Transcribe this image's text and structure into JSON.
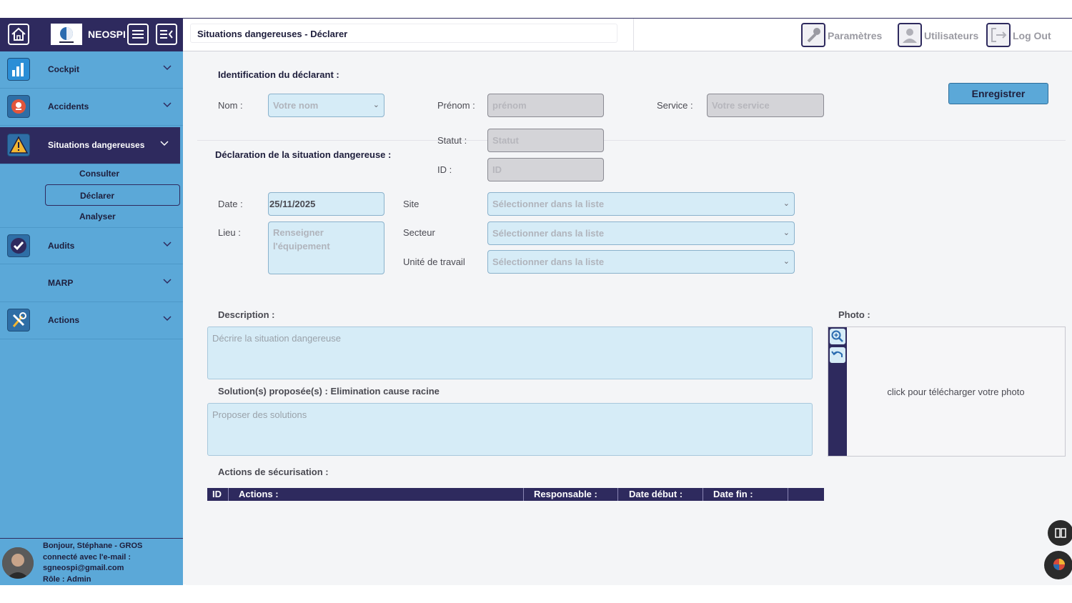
{
  "sidebar": {
    "brand": "NEOSPI",
    "items": [
      {
        "label": "Cockpit"
      },
      {
        "label": "Accidents"
      },
      {
        "label": "Situations dangereuses"
      },
      {
        "label": "Audits"
      },
      {
        "label": "MARP"
      },
      {
        "label": "Actions"
      }
    ],
    "subitems": [
      {
        "label": "Consulter"
      },
      {
        "label": "Déclarer"
      },
      {
        "label": "Analyser"
      }
    ],
    "user": {
      "line1": "Bonjour, Stéphane - GROS",
      "line2": "connecté avec l'e-mail :",
      "line3": "sgneospi@gmail.com",
      "line4": "Rôle : Admin"
    }
  },
  "header": {
    "title": "Situations dangereuses - Déclarer",
    "buttons": [
      {
        "label": "Paramètres"
      },
      {
        "label": "Utilisateurs"
      },
      {
        "label": "Log Out"
      }
    ]
  },
  "form": {
    "ident_title": "Identification du déclarant :",
    "save_label": "Enregistrer",
    "nom_label": "Nom :",
    "nom_placeholder": "Votre nom",
    "prenom_label": "Prénom :",
    "prenom_placeholder": "prénom",
    "service_label": "Service :",
    "service_placeholder": "Votre service",
    "decl_title": "Déclaration de la situation dangereuse :",
    "statut_label": "Statut :",
    "statut_placeholder": "Statut",
    "id_label": "ID :",
    "id_placeholder": "ID",
    "date_label": "Date :",
    "date_value": "25/11/2025",
    "site_label": "Site",
    "site_placeholder": "Sélectionner dans la liste",
    "lieu_label": "Lieu :",
    "lieu_placeholder": "Renseigner l'équipement",
    "secteur_label": "Secteur",
    "secteur_placeholder": "Sélectionner dans la liste",
    "unite_label": "Unité de travail",
    "unite_placeholder": "Sélectionner dans la liste",
    "description_title": "Description :",
    "description_placeholder": "Décrire la situation dangereuse",
    "solutions_title": "Solution(s) proposée(s) : Elimination cause racine",
    "solutions_placeholder": "Proposer des solutions",
    "photo_title": "Photo :",
    "photo_hint": "click pour télécharger votre photo",
    "actions_title": "Actions de sécurisation :",
    "table_headers": [
      "ID",
      "Actions :",
      "Responsable :",
      "Date début :",
      "Date fin :"
    ]
  },
  "colors": {
    "navy": "#2e2a5e",
    "sidebar_blue": "#5ba8d8",
    "input_light": "#d6ecf7"
  }
}
